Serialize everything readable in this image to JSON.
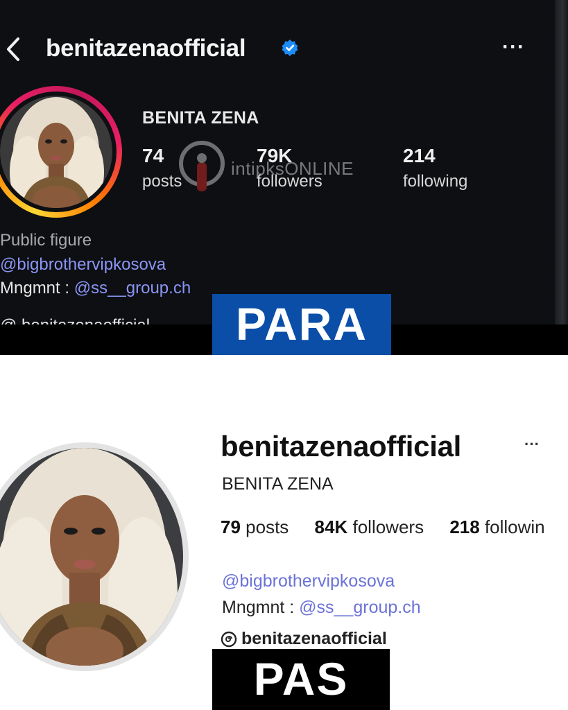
{
  "top_screenshot": {
    "header": {
      "username": "benitazenaofficial",
      "more_label": "···"
    },
    "profile": {
      "display_name": "BENITA ZENA",
      "stats": [
        {
          "value": "74",
          "label": "posts"
        },
        {
          "value": "79K",
          "label": "followers"
        },
        {
          "value": "214",
          "label": "following"
        }
      ],
      "category": "Public figure",
      "bio_link": "@bigbrothervipkosova",
      "management_prefix": "Mngmnt : ",
      "management_link": "@ss__group.ch",
      "truncated_line": "@ benitazenaofficial"
    },
    "watermark": "intipksONLINE",
    "label": "PARA",
    "colors": {
      "label_bg": "#0a4ea8",
      "link": "#8b95f5",
      "verified": "#1d8cf8"
    }
  },
  "bottom_screenshot": {
    "header": {
      "username": "benitazenaofficial",
      "more_label": "···"
    },
    "profile": {
      "display_name": "BENITA ZENA",
      "stats": [
        {
          "value": "79",
          "label": "posts"
        },
        {
          "value": "84K",
          "label": "followers"
        },
        {
          "value": "218",
          "label": "followin"
        }
      ],
      "bio_link": "@bigbrothervipkosova",
      "management_prefix": "Mngmnt : ",
      "management_link": "@ss__group.ch",
      "threads_handle": "benitazenaofficial"
    },
    "label": "PAS",
    "colors": {
      "label_bg": "#000000",
      "link": "#6b72d8"
    }
  },
  "icons": [
    "back-chevron-icon",
    "verified-badge-icon",
    "more-options-icon",
    "threads-icon",
    "watermark-logo-icon"
  ]
}
